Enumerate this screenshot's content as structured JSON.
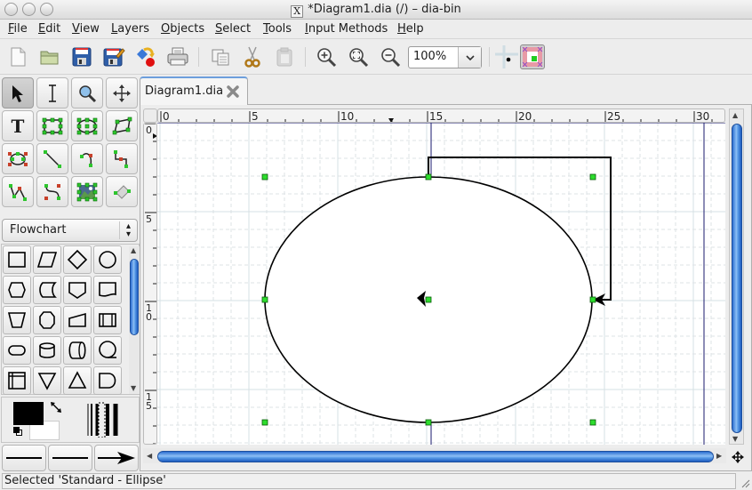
{
  "window": {
    "title": "*Diagram1.dia (/) – dia-bin"
  },
  "menubar": {
    "items": [
      {
        "label": "File",
        "mnemonic": "F",
        "rest": "ile"
      },
      {
        "label": "Edit",
        "mnemonic": "E",
        "rest": "dit"
      },
      {
        "label": "View",
        "mnemonic": "V",
        "rest": "iew"
      },
      {
        "label": "Layers",
        "mnemonic": "L",
        "rest": "ayers"
      },
      {
        "label": "Objects",
        "mnemonic": "O",
        "rest": "bjects"
      },
      {
        "label": "Select",
        "mnemonic": "S",
        "rest": "elect"
      },
      {
        "label": "Tools",
        "mnemonic": "T",
        "rest": "ools"
      },
      {
        "label": "Input Methods",
        "mnemonic": "I",
        "rest": "nput Methods"
      },
      {
        "label": "Help",
        "mnemonic": "H",
        "rest": "elp"
      }
    ]
  },
  "toolbar": {
    "buttons": [
      "new-document-icon",
      "open-folder-icon",
      "save-icon",
      "save-as-icon",
      "export-icon",
      "print-icon",
      "copy-icon",
      "cut-icon",
      "paste-icon",
      "zoom-in-icon",
      "zoom-fit-icon",
      "zoom-out-icon"
    ],
    "zoom_value": "100%",
    "snap_to_grid": false,
    "snap_to_objects": true
  },
  "toolbox": {
    "tools": [
      "pointer",
      "text-edit",
      "magnify",
      "scroll",
      "text",
      "box",
      "ellipse",
      "polygon",
      "beziergon",
      "line",
      "arc",
      "zigzag-line",
      "polyline",
      "bezier-line",
      "image",
      "outline"
    ],
    "active_tool": "pointer"
  },
  "sheet": {
    "selected": "Flowchart",
    "shapes": [
      "process",
      "data",
      "decision",
      "connector",
      "preparation",
      "stored-data",
      "off-page-connector",
      "document",
      "manual-operation",
      "terminal",
      "manual-input",
      "predefined-process",
      "terminator",
      "magnetic-disk",
      "direct-access-storage",
      "sequential-access-storage",
      "internal-storage",
      "merge",
      "extract",
      "delay"
    ]
  },
  "colors": {
    "foreground": "#000000",
    "background": "#ffffff",
    "handle": "#22dd22"
  },
  "document": {
    "tab_label": "Diagram1.dia",
    "hruler_labels": [
      "0",
      "5",
      "10",
      "15",
      "20",
      "25",
      "30"
    ],
    "vruler_labels": [
      "0",
      "5",
      "1\n0",
      "1\n5"
    ]
  },
  "status": {
    "text": "Selected 'Standard - Ellipse'"
  }
}
